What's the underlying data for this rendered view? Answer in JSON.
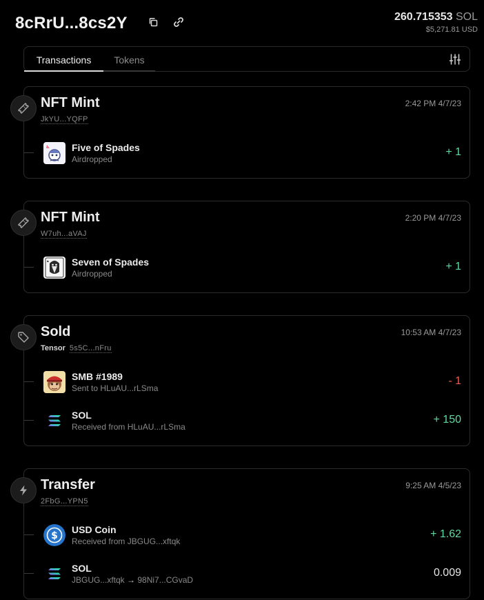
{
  "header": {
    "wallet_name": "8cRrU...8cs2Y",
    "balance_amount": "260.715353",
    "balance_unit": "SOL",
    "balance_usd": "$5,271.81 USD"
  },
  "tabs": [
    {
      "label": "Transactions",
      "active": true
    },
    {
      "label": "Tokens",
      "active": false
    }
  ],
  "colors": {
    "positive": "#62d9a0",
    "negative": "#ec5d4f",
    "background": "#000000",
    "card_border": "#2c2c2c"
  },
  "transactions": [
    {
      "type": "NFT Mint",
      "icon": "ticket-icon",
      "signature": "JkYU...YQFP",
      "time": "2:42 PM 4/7/23",
      "items": [
        {
          "name": "Five of Spades",
          "desc": "Airdropped",
          "amount": "+ 1",
          "sign": "positive",
          "icon": "card-nft-image"
        }
      ]
    },
    {
      "type": "NFT Mint",
      "icon": "ticket-icon",
      "signature": "W7uh...aVAJ",
      "time": "2:20 PM 4/7/23",
      "items": [
        {
          "name": "Seven of Spades",
          "desc": "Airdropped",
          "amount": "+ 1",
          "sign": "positive",
          "icon": "card-nft-image"
        }
      ]
    },
    {
      "type": "Sold",
      "icon": "tag-icon",
      "market": "Tensor",
      "signature": "5s5C...nFru",
      "time": "10:53 AM 4/7/23",
      "items": [
        {
          "name": "SMB #1989",
          "desc_prefix": "Sent to",
          "desc_addr": "HLuAU...rLSma",
          "amount": "- 1",
          "sign": "negative",
          "icon": "monkey-nft-image"
        },
        {
          "name": "SOL",
          "desc_prefix": "Received from",
          "desc_addr": "HLuAU...rLSma",
          "amount": "+ 150",
          "sign": "positive",
          "icon": "solana-icon"
        }
      ]
    },
    {
      "type": "Transfer",
      "icon": "lightning-icon",
      "signature": "2FbG...YPN5",
      "time": "9:25 AM 4/5/23",
      "items": [
        {
          "name": "USD Coin",
          "desc_prefix": "Received from",
          "desc_addr": "JBGUG...xftqk",
          "amount": "+ 1.62",
          "sign": "positive",
          "icon": "usdc-icon"
        },
        {
          "name": "SOL",
          "desc_from": "JBGUG...xftqk",
          "desc_arrow": "→",
          "desc_to": "98Ni7...CGvaD",
          "amount": "0.009",
          "sign": "neutral",
          "icon": "solana-icon"
        }
      ]
    }
  ]
}
